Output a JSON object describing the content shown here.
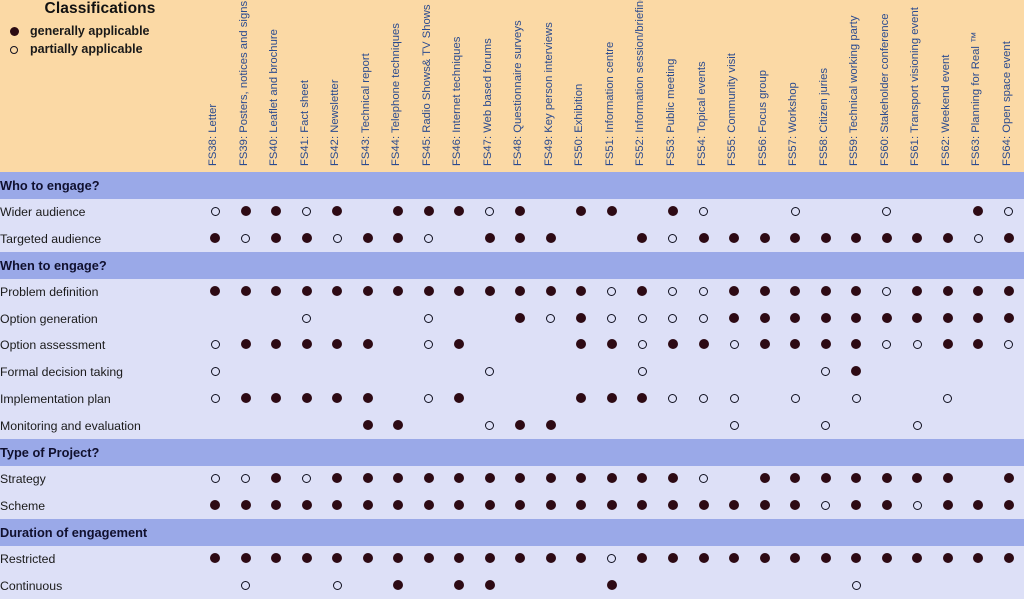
{
  "legend": {
    "title": "Classifications",
    "items": [
      {
        "marker": "filled",
        "label": "generally applicable"
      },
      {
        "marker": "open",
        "label": "partially applicable"
      }
    ]
  },
  "columns": [
    "FS38: Letter",
    "FS39: Posters, notices and signs",
    "FS40: Leaflet and brochure",
    "FS41: Fact sheet",
    "FS42: Newsletter",
    "FS43: Technical report",
    "FS44: Telephone techniques",
    "FS45: Radio Shows& TV Shows",
    "FS46: Internet techniques",
    "FS47: Web based forums",
    "FS48: Questionnaire surveys",
    "FS49: Key person interviews",
    "FS50: Exhibition",
    "FS51: Information centre",
    "FS52: Information session/briefing",
    "FS53: Public meeting",
    "FS54: Topical events",
    "FS55: Community visit",
    "FS56: Focus group",
    "FS57: Workshop",
    "FS58: Citizen juries",
    "FS59: Technical working party",
    "FS60: Stakeholder conference",
    "FS61: Transport visioning event",
    "FS62: Weekend event",
    "FS63: Planning for Real ™",
    "FS64: Open space event"
  ],
  "sections": [
    {
      "title": "Who to engage?",
      "rows": [
        {
          "label": "Wider audience",
          "values": [
            "O",
            "F",
            "F",
            "O",
            "F",
            "",
            "F",
            "F",
            "F",
            "O",
            "F",
            "",
            "F",
            "F",
            "",
            "F",
            "O",
            "",
            "",
            "O",
            "",
            "",
            "O",
            "",
            "",
            "F",
            "O"
          ]
        },
        {
          "label": "Targeted audience",
          "values": [
            "F",
            "O",
            "F",
            "F",
            "O",
            "F",
            "F",
            "O",
            "",
            "F",
            "F",
            "F",
            "",
            "",
            "F",
            "O",
            "F",
            "F",
            "F",
            "F",
            "F",
            "F",
            "F",
            "F",
            "F",
            "O",
            "F"
          ]
        }
      ]
    },
    {
      "title": "When to engage?",
      "rows": [
        {
          "label": "Problem definition",
          "values": [
            "F",
            "F",
            "F",
            "F",
            "F",
            "F",
            "F",
            "F",
            "F",
            "F",
            "F",
            "F",
            "F",
            "O",
            "F",
            "O",
            "O",
            "F",
            "F",
            "F",
            "F",
            "F",
            "O",
            "F",
            "F",
            "F",
            "F"
          ]
        },
        {
          "label": "Option generation",
          "values": [
            "",
            "",
            "",
            "O",
            "",
            "",
            "",
            "O",
            "",
            "",
            "F",
            "O",
            "F",
            "O",
            "O",
            "O",
            "O",
            "F",
            "F",
            "F",
            "F",
            "F",
            "F",
            "F",
            "F",
            "F",
            "F"
          ]
        },
        {
          "label": "Option assessment",
          "values": [
            "O",
            "F",
            "F",
            "F",
            "F",
            "F",
            "",
            "O",
            "F",
            "",
            "",
            "",
            "F",
            "F",
            "O",
            "F",
            "F",
            "O",
            "F",
            "F",
            "F",
            "F",
            "O",
            "O",
            "F",
            "F",
            "O"
          ]
        },
        {
          "label": "Formal decision taking",
          "values": [
            "O",
            "",
            "",
            "",
            "",
            "",
            "",
            "",
            "",
            "O",
            "",
            "",
            "",
            "",
            "O",
            "",
            "",
            "",
            "",
            "",
            "O",
            "F",
            "",
            "",
            "",
            "",
            ""
          ]
        },
        {
          "label": "Implementation plan",
          "values": [
            "O",
            "F",
            "F",
            "F",
            "F",
            "F",
            "",
            "O",
            "F",
            "",
            "",
            "",
            "F",
            "F",
            "F",
            "O",
            "O",
            "O",
            "",
            "O",
            "",
            "O",
            "",
            "",
            "O",
            "",
            ""
          ]
        },
        {
          "label": "Monitoring and evaluation",
          "values": [
            "",
            "",
            "",
            "",
            "",
            "F",
            "F",
            "",
            "",
            "O",
            "F",
            "F",
            "",
            "",
            "",
            "",
            "",
            "O",
            "",
            "",
            "O",
            "",
            "",
            "O",
            "",
            "",
            ""
          ]
        }
      ]
    },
    {
      "title": "Type of Project?",
      "rows": [
        {
          "label": "Strategy",
          "values": [
            "O",
            "O",
            "F",
            "O",
            "F",
            "F",
            "F",
            "F",
            "F",
            "F",
            "F",
            "F",
            "F",
            "F",
            "F",
            "F",
            "O",
            "",
            "F",
            "F",
            "F",
            "F",
            "F",
            "F",
            "F",
            "",
            "F"
          ]
        },
        {
          "label": "Scheme",
          "values": [
            "F",
            "F",
            "F",
            "F",
            "F",
            "F",
            "F",
            "F",
            "F",
            "F",
            "F",
            "F",
            "F",
            "F",
            "F",
            "F",
            "F",
            "F",
            "F",
            "F",
            "O",
            "F",
            "F",
            "O",
            "F",
            "F",
            "F"
          ]
        }
      ]
    },
    {
      "title": "Duration of engagement",
      "rows": [
        {
          "label": "Restricted",
          "values": [
            "F",
            "F",
            "F",
            "F",
            "F",
            "F",
            "F",
            "F",
            "F",
            "F",
            "F",
            "F",
            "F",
            "O",
            "F",
            "F",
            "F",
            "F",
            "F",
            "F",
            "F",
            "F",
            "F",
            "F",
            "F",
            "F",
            "F"
          ]
        },
        {
          "label": "Continuous",
          "values": [
            "",
            "O",
            "",
            "",
            "O",
            "",
            "F",
            "",
            "F",
            "F",
            "",
            "",
            "",
            "F",
            "",
            "",
            "",
            "",
            "",
            "",
            "",
            "O",
            "",
            "",
            "",
            "",
            ""
          ]
        }
      ]
    }
  ],
  "colors": {
    "header_background": "#fbd9a5",
    "section_background": "#9aa9e8",
    "row_background": "#dde0f7",
    "header_text": "#2b4b8f",
    "marker_fill": "#2d0a14"
  }
}
